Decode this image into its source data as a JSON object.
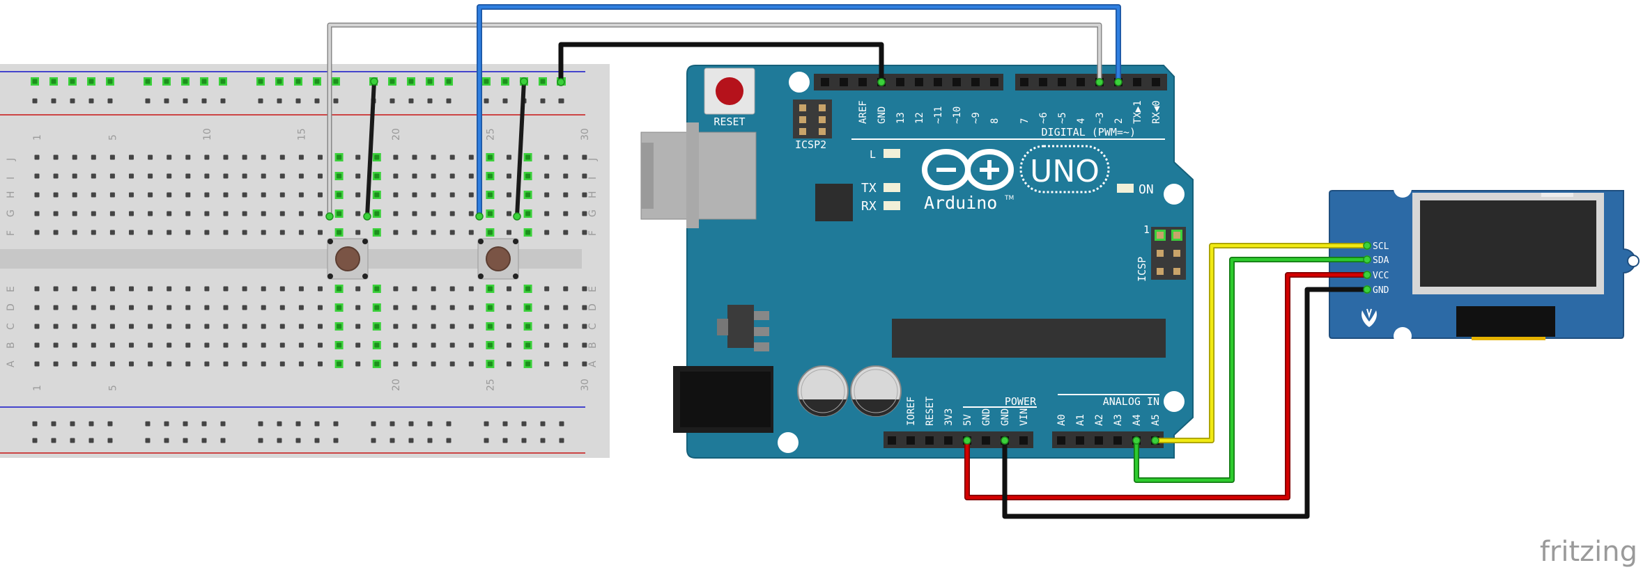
{
  "breadboard": {
    "top_numbers": [
      "1",
      "5",
      "10",
      "15",
      "20",
      "25",
      "30"
    ],
    "bottom_numbers": [
      "1",
      "5",
      "20",
      "25",
      "30"
    ],
    "row_letters_top": [
      "J",
      "I",
      "H",
      "G",
      "F"
    ],
    "row_letters_bottom": [
      "E",
      "D",
      "C",
      "B",
      "A"
    ]
  },
  "arduino": {
    "reset_label": "RESET",
    "icsp2_label": "ICSP2",
    "icsp_label": "ICSP",
    "icsp_pin1": "1",
    "digital_label": "DIGITAL (PWM=~)",
    "digital_pins": [
      "AREF",
      "GND",
      "13",
      "12",
      "~11",
      "~10",
      "~9",
      "8",
      "7",
      "~6",
      "~5",
      "4",
      "~3",
      "2",
      "TX▶1",
      "RX◀0"
    ],
    "led_l": "L",
    "led_tx": "TX",
    "led_rx": "RX",
    "led_on": "ON",
    "brand": "Arduino",
    "tm": "TM",
    "model": "UNO",
    "power_label": "POWER",
    "power_pins": [
      "IOREF",
      "RESET",
      "3V3",
      "5V",
      "GND",
      "GND",
      "VIN"
    ],
    "analog_label": "ANALOG IN",
    "analog_pins": [
      "A0",
      "A1",
      "A2",
      "A3",
      "A4",
      "A5"
    ]
  },
  "oled": {
    "pins": [
      "SCL",
      "SDA",
      "VCC",
      "GND"
    ]
  },
  "footer": {
    "logo": "fritzing"
  },
  "colors": {
    "board": "#1f7a99",
    "board_edge": "#15607a",
    "breadboard": "#d9d9d9",
    "wire_white": "#c8c8c8",
    "wire_blue": "#2a72d0",
    "wire_black": "#222222",
    "wire_yellow": "#e6e000",
    "wire_green": "#21b321",
    "wire_red": "#cc0000",
    "grove_blue": "#2c6aa6"
  }
}
